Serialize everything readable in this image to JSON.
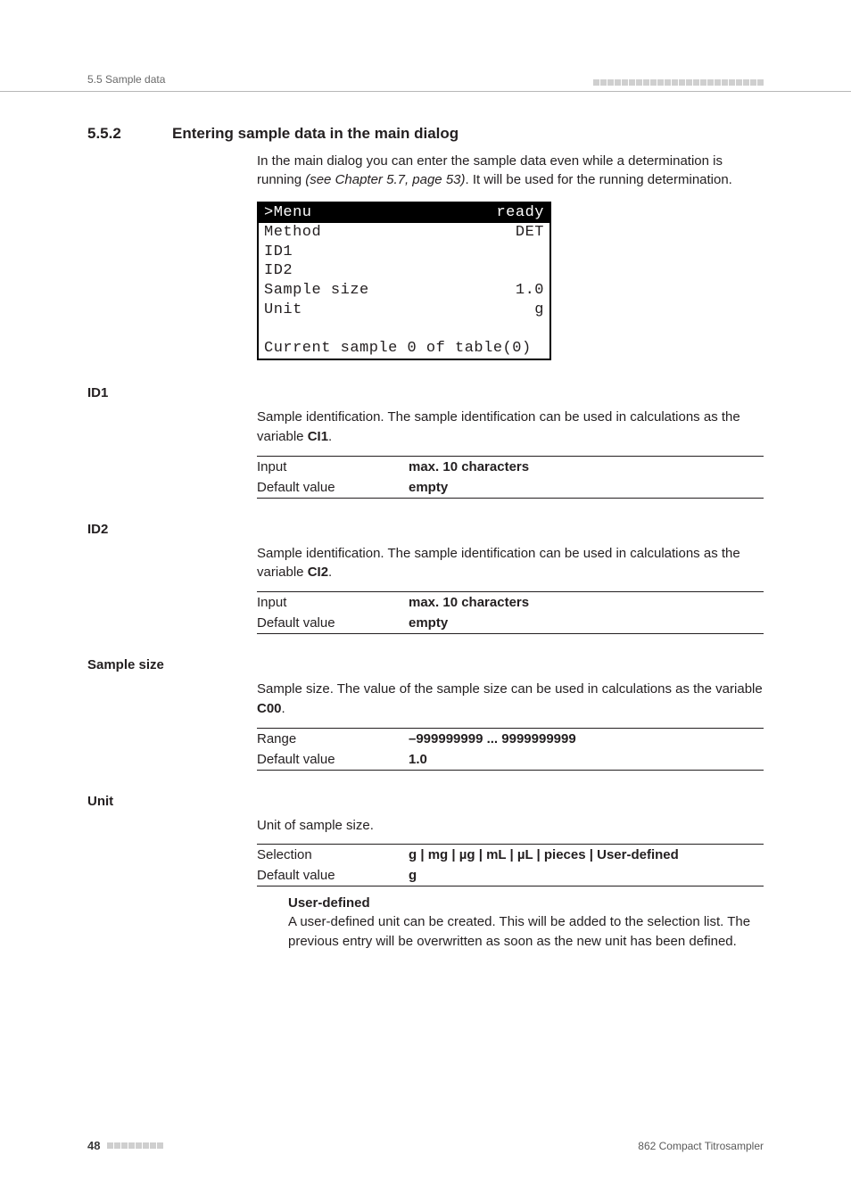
{
  "header": {
    "breadcrumb": "5.5 Sample data"
  },
  "section": {
    "number": "5.5.2",
    "title": "Entering sample data in the main dialog",
    "intro_pre": "In the main dialog you can enter the sample data even while a determination is running ",
    "intro_ital": "(see Chapter 5.7, page 53)",
    "intro_post": ". It will be used for the running determination."
  },
  "lcd": {
    "top_left": ">Menu",
    "top_right": "ready",
    "rows": [
      {
        "l": "Method",
        "r": "DET"
      },
      {
        "l": "ID1",
        "r": ""
      },
      {
        "l": "ID2",
        "r": ""
      },
      {
        "l": "Sample size",
        "r": "1.0"
      },
      {
        "l": "Unit",
        "r": "g"
      }
    ],
    "bottom": "Current sample  0 of table(0)"
  },
  "fields": {
    "id1": {
      "label": "ID1",
      "desc_pre": "Sample identification. The sample identification can be used in calculations as the variable ",
      "desc_var": "CI1",
      "desc_post": ".",
      "rows": [
        {
          "k": "Input",
          "v": "max. 10 characters"
        },
        {
          "k": "Default value",
          "v": "empty"
        }
      ]
    },
    "id2": {
      "label": "ID2",
      "desc_pre": "Sample identification. The sample identification can be used in calculations as the variable ",
      "desc_var": "CI2",
      "desc_post": ".",
      "rows": [
        {
          "k": "Input",
          "v": "max. 10 characters"
        },
        {
          "k": "Default value",
          "v": "empty"
        }
      ]
    },
    "sample_size": {
      "label": "Sample size",
      "desc_pre": "Sample size. The value of the sample size can be used in calculations as the variable ",
      "desc_var": "C00",
      "desc_post": ".",
      "rows": [
        {
          "k": "Range",
          "v": "–999999999 ... 9999999999"
        },
        {
          "k": "Default value",
          "v": "1.0"
        }
      ]
    },
    "unit": {
      "label": "Unit",
      "desc": "Unit of sample size.",
      "rows": [
        {
          "k": "Selection",
          "v": "g | mg | µg | mL | µL | pieces | User-defined"
        },
        {
          "k": "Default value",
          "v": "g"
        }
      ],
      "sub": {
        "title": "User-defined",
        "body": "A user-defined unit can be created. This will be added to the selection list. The previous entry will be overwritten as soon as the new unit has been defined."
      }
    }
  },
  "footer": {
    "page": "48",
    "product": "862 Compact Titrosampler"
  }
}
